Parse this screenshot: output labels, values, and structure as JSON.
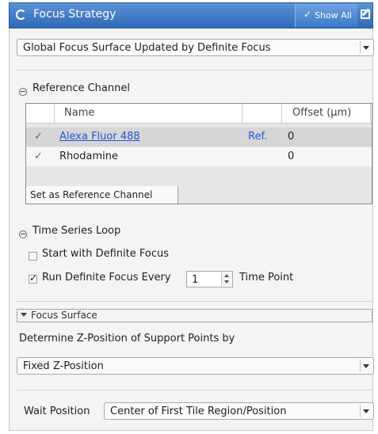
{
  "header": {
    "title": "Focus Strategy",
    "show_all_label": "Show All"
  },
  "strategy_select": {
    "value": "Global Focus Surface Updated by Definite Focus"
  },
  "reference_channel": {
    "section_label": "Reference Channel",
    "columns": [
      "Name",
      "Offset (µm)"
    ],
    "rows": [
      {
        "check": "✓",
        "name": "Alexa Fluor 488",
        "ref": "Ref.",
        "offset": "0"
      },
      {
        "check": "✓",
        "name": "Rhodamine",
        "ref": "",
        "offset": "0"
      }
    ],
    "set_reference_label": "Set as Reference Channel"
  },
  "time_series": {
    "section_label": "Time Series Loop",
    "start_with_df_label": "Start with Definite Focus",
    "start_with_df_checked": false,
    "run_df_every_label": "Run Definite Focus Every",
    "run_df_every_checked": true,
    "run_df_every_value": "1",
    "time_point_label": "Time Point"
  },
  "focus_surface": {
    "section_label": "Focus Surface",
    "support_points_label": "Determine Z-Position of Support Points by",
    "support_points_value": "Fixed Z-Position",
    "wait_position_label": "Wait Position",
    "wait_position_value": "Center of First Tile Region/Position"
  }
}
